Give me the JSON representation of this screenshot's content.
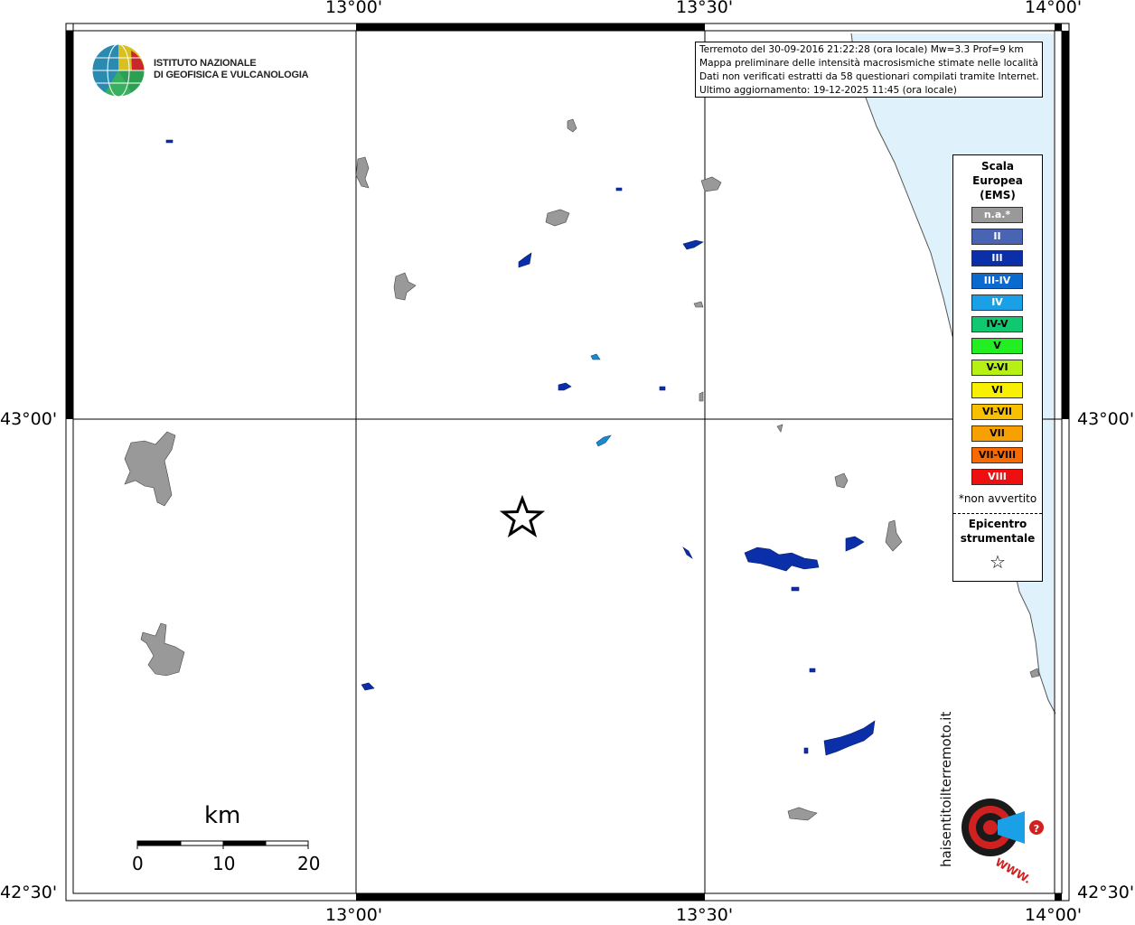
{
  "coords": {
    "top_lon_1": "13°00'",
    "top_lon_2": "13°30'",
    "top_lon_3": "14°00'",
    "bottom_lon_1": "13°00'",
    "bottom_lon_2": "13°30'",
    "bottom_lon_3": "14°00'",
    "left_lat_1": "43°00'",
    "left_lat_2": "42°30'",
    "right_lat_1": "43°00'",
    "right_lat_2": "42°30'"
  },
  "logo": {
    "line1": "ISTITUTO NAZIONALE",
    "line2": "DI GEOFISICA E VULCANOLOGIA"
  },
  "info": {
    "line1": "Terremoto del 30-09-2016 21:22:28 (ora locale) Mw=3.3 Prof=9 km",
    "line2": "Mappa preliminare delle intensità macrosismiche stimate nelle località",
    "line3": "Dati non verificati estratti da 58 questionari compilati tramite Internet.",
    "line4": "Ultimo aggiornamento: 19-12-2025 11:45 (ora locale)"
  },
  "legend": {
    "title1": "Scala",
    "title2": "Europea",
    "title3": "(EMS)",
    "items": [
      {
        "label": "n.a.*",
        "color": "#999999",
        "text_color": "#ffffff"
      },
      {
        "label": "II",
        "color": "#4a64b4",
        "text_color": "#ffffff"
      },
      {
        "label": "III",
        "color": "#0a2fa8",
        "text_color": "#ffffff"
      },
      {
        "label": "III-IV",
        "color": "#0a6ad0",
        "text_color": "#ffffff"
      },
      {
        "label": "IV",
        "color": "#1aa0e6",
        "text_color": "#ffffff"
      },
      {
        "label": "IV-V",
        "color": "#10c870",
        "text_color": "#000000"
      },
      {
        "label": "V",
        "color": "#22ee22",
        "text_color": "#000000"
      },
      {
        "label": "V-VI",
        "color": "#b6f014",
        "text_color": "#000000"
      },
      {
        "label": "VI",
        "color": "#f8f000",
        "text_color": "#000000"
      },
      {
        "label": "VI-VII",
        "color": "#f8c000",
        "text_color": "#000000"
      },
      {
        "label": "VII",
        "color": "#f8a000",
        "text_color": "#000000"
      },
      {
        "label": "VII-VIII",
        "color": "#f86a00",
        "text_color": "#000000"
      },
      {
        "label": "VIII",
        "color": "#ee1010",
        "text_color": "#ffffff"
      }
    ],
    "note": "*non avvertito",
    "epi1": "Epicentro",
    "epi2": "strumentale",
    "star": "☆"
  },
  "scale": {
    "title": "km",
    "l0": "0",
    "l10": "10",
    "l20": "20"
  },
  "badge": {
    "text": "haisentitoilterremoto.it",
    "www": "WWW."
  },
  "colors": {
    "sea": "#dff1fb",
    "na_area": "#999999",
    "iii_area": "#0a2fa8",
    "iv_area": "#1a8ad0"
  }
}
